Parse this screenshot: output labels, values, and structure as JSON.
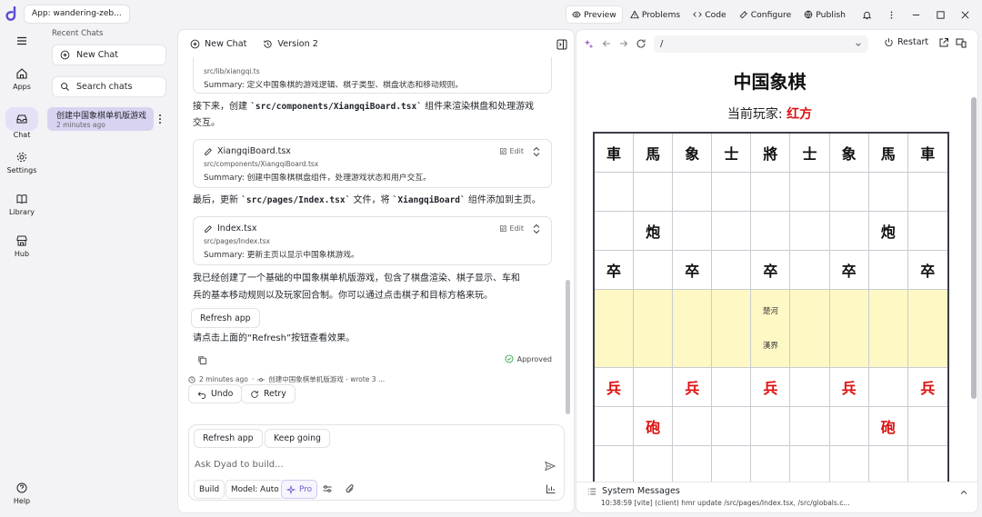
{
  "app": {
    "tag": "App: wandering-zeb..."
  },
  "topnav": {
    "preview": "Preview",
    "problems": "Problems",
    "code": "Code",
    "configure": "Configure",
    "publish": "Publish"
  },
  "rail": {
    "apps": "Apps",
    "chat": "Chat",
    "settings": "Settings",
    "library": "Library",
    "hub": "Hub",
    "help": "Help"
  },
  "chatlist": {
    "recent_label": "Recent Chats",
    "new_chat": "New Chat",
    "search": "Search chats",
    "items": [
      {
        "title": "创建中国象棋单机版游戏",
        "time": "2 minutes ago"
      }
    ]
  },
  "chat": {
    "header": {
      "new_chat": "New Chat",
      "version": "Version 2"
    },
    "card0": {
      "path": "src/lib/xiangqi.ts",
      "summary": "Summary: 定义中国象棋的游戏逻辑、棋子类型、棋盘状态和移动规则。"
    },
    "para1_a": "接下来，创建 ",
    "para1_code": "`src/components/XiangqiBoard.tsx`",
    "para1_b": " 组件来渲染棋盘和处理游戏",
    "para1_c": "交互。",
    "card1": {
      "name": "XiangqiBoard.tsx",
      "path": "src/components/XiangqiBoard.tsx",
      "summary": "Summary: 创建中国象棋棋盘组件，处理游戏状态和用户交互。",
      "edit": "Edit"
    },
    "para2_a": "最后，更新 ",
    "para2_code1": "`src/pages/Index.tsx`",
    "para2_b": " 文件，将 ",
    "para2_code2": "`XiangqiBoard`",
    "para2_c": " 组件添加到主页。",
    "card2": {
      "name": "Index.tsx",
      "path": "src/pages/Index.tsx",
      "summary": "Summary: 更新主页以显示中国象棋游戏。",
      "edit": "Edit"
    },
    "para3_l1": "我已经创建了一个基础的中国象棋单机版游戏，包含了棋盘渲染、棋子显示、车和",
    "para3_l2": "兵的基本移动规则以及玩家回合制。你可以通过点击棋子和目标方格来玩。",
    "refresh_chip": "Refresh app",
    "para4": "请点击上面的“Refresh”按钮查看效果。",
    "approved": "Approved",
    "meta": "2 minutes ago",
    "meta_sep": "·",
    "meta_msg": "创建中国象棋单机版游戏 - wrote 3 ...",
    "undo": "Undo",
    "retry": "Retry"
  },
  "composer": {
    "refresh": "Refresh app",
    "keep_going": "Keep going",
    "placeholder": "Ask Dyad to build...",
    "build": "Build",
    "model": "Model: Auto",
    "pro": "Pro"
  },
  "preview": {
    "url": "/",
    "restart": "Restart",
    "title": "中国象棋",
    "player_label": "当前玩家: ",
    "player_value": "红方",
    "river_left": "楚河",
    "river_right": "漢界",
    "colors": {
      "red_piece": "#dd1111",
      "river": "#fdf8c4",
      "accent": "#6d5bd0"
    },
    "board_rows": [
      {
        "cells": [
          "車",
          "馬",
          "象",
          "士",
          "將",
          "士",
          "象",
          "馬",
          "車"
        ],
        "side": "black"
      },
      {
        "cells": [
          "",
          "",
          "",
          "",
          "",
          "",
          "",
          "",
          ""
        ],
        "side": "black"
      },
      {
        "cells": [
          "",
          "炮",
          "",
          "",
          "",
          "",
          "",
          "炮",
          ""
        ],
        "side": "black"
      },
      {
        "cells": [
          "卒",
          "",
          "卒",
          "",
          "卒",
          "",
          "卒",
          "",
          "卒"
        ],
        "side": "black"
      },
      {
        "cells": [
          "兵",
          "",
          "兵",
          "",
          "兵",
          "",
          "兵",
          "",
          "兵"
        ],
        "side": "red"
      },
      {
        "cells": [
          "",
          "砲",
          "",
          "",
          "",
          "",
          "",
          "砲",
          ""
        ],
        "side": "red"
      },
      {
        "cells": [
          "",
          "",
          "",
          "",
          "",
          "",
          "",
          "",
          ""
        ],
        "side": "red"
      }
    ]
  },
  "system": {
    "title": "System Messages",
    "log": "10:38:59 [vite] (client) hmr update /src/pages/Index.tsx, /src/globals.c..."
  }
}
